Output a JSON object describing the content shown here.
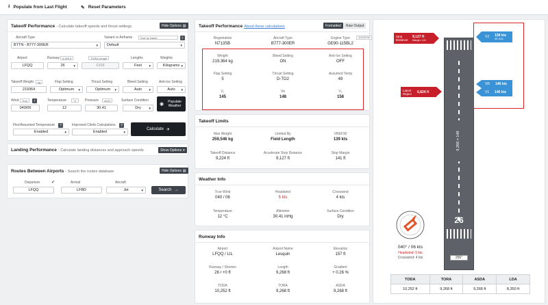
{
  "toolbar": {
    "populate": "Populate from Last Flight",
    "reset": "Reset Parameters"
  },
  "takeoff": {
    "title": "Takeoff Performance",
    "subtitle": "- Calculate takeoff speeds and thrust settings",
    "hide": "Hide Options",
    "aircraft_type_label": "Aircraft Type",
    "aircraft_type": "BTTN - B777-300ER",
    "variant_label": "Variant or Airframe",
    "sort": "Sort by Name",
    "variant": "Default",
    "airport_label": "Airport",
    "airport": "LFQQ",
    "runway_label": "Runway",
    "runway_tag": "5,269 ft",
    "runway": "26",
    "length_tag": "TORA Length",
    "length": "5268",
    "lengths_label": "Lengths",
    "lengths": "Feet",
    "weights_label": "Weights",
    "weights": "Kilograms",
    "tow_label": "Takeoff Weight",
    "tow_tag": "kg",
    "tow": "219364",
    "flap_label": "Flap Setting",
    "flap": "Optimum",
    "thrust_label": "Thrust Setting",
    "thrust": "Optimum",
    "bleed_label": "Bleed Setting",
    "bleed": "Auto",
    "antiice_label": "Anti-Ice Setting",
    "antiice": "Auto",
    "wind_label": "Wind",
    "wind_tag": "True",
    "wind": "040/06",
    "temp_label": "Temperature",
    "temp_tag": "°C",
    "temp": "12",
    "press_label": "Pressure",
    "press_tag": "inHG",
    "press": "30.41",
    "surface_label": "Surface Condition",
    "surface": "Dry",
    "populate_weather": "Populate Weather",
    "flex_label": "Flex/Assumed Temperature",
    "flex": "Enabled",
    "climb_label": "Improved Climb Calculations",
    "climb": "Enabled",
    "calculate": "Calculate"
  },
  "landing": {
    "title": "Landing Performance",
    "subtitle": "- Calculate landing distances and approach speeds",
    "show": "Show Options"
  },
  "routes": {
    "title": "Routes Between Airports",
    "subtitle": "- Search the routes database",
    "hide": "Hide Options",
    "dep_label": "Departure",
    "dep": "LFQQ",
    "arr_label": "Arrival",
    "arr": "LFBD",
    "ac_label": "Aircraft",
    "ac": "Jet",
    "search": "Search"
  },
  "result": {
    "title": "Takeoff Performance",
    "link": "About these calculations",
    "fmt": "Formatted",
    "raw": "Raw Output",
    "rows": [
      [
        {
          "k": "Registration",
          "v": "N713SB"
        },
        {
          "k": "Aircraft Type",
          "v": "B777-300ER"
        },
        {
          "k": "Engine Type",
          "v": "GE90-115BL2",
          "tag": "116,000 lbf"
        }
      ],
      [
        {
          "k": "Weight",
          "v": "219,364 kg"
        },
        {
          "k": "Bleed Setting",
          "v": "ON"
        },
        {
          "k": "Anti-Ice Setting",
          "v": "OFF"
        }
      ],
      [
        {
          "k": "Flap Setting",
          "v": "5"
        },
        {
          "k": "Thrust Setting",
          "v": "D-TO2"
        },
        {
          "k": "Assumed Temp",
          "v": "49"
        }
      ],
      [
        {
          "k": "V₁",
          "v": "145"
        },
        {
          "k": "Vʀ",
          "v": "148"
        },
        {
          "k": "V₂",
          "v": "158"
        }
      ]
    ]
  },
  "limits": {
    "title": "Takeoff Limits",
    "rows": [
      [
        {
          "k": "Max Weight",
          "v": "259,546 kg"
        },
        {
          "k": "Limited By",
          "v": "Field Length"
        },
        {
          "k": "VREF30",
          "v": "139 kts"
        }
      ],
      [
        {
          "k": "Takeoff Distance",
          "v": "9,224 ft"
        },
        {
          "k": "Accelerate Stop Distance",
          "v": "9,127 ft"
        },
        {
          "k": "Stop Margin",
          "v": "141 ft"
        }
      ]
    ]
  },
  "weather": {
    "title": "Weather Info",
    "rows": [
      [
        {
          "k": "True Wind",
          "v": "040 / 06"
        },
        {
          "k": "Headwind",
          "v": "5 kts"
        },
        {
          "k": "Crosswind",
          "v": "4 kts"
        }
      ],
      [
        {
          "k": "Temperature",
          "v": "12 °C"
        },
        {
          "k": "Altimeter",
          "v": "30.41 inHg"
        },
        {
          "k": "Surface Condition",
          "v": "Dry"
        }
      ]
    ]
  },
  "runway": {
    "title": "Runway Info",
    "rows": [
      [
        {
          "k": "Airport",
          "v": "LFQQ / LIL"
        },
        {
          "k": "Airport Name",
          "v": "Lesquin"
        },
        {
          "k": "Elevation",
          "v": "157 ft"
        }
      ],
      [
        {
          "k": "Runway / Shorten",
          "v": "26 / +0 ft"
        },
        {
          "k": "Length",
          "v": "9,268 ft"
        },
        {
          "k": "Gradient",
          "v": "+ 0.26 %"
        }
      ],
      [
        {
          "k": "TODA",
          "v": "10,252 ft"
        },
        {
          "k": "TORA",
          "v": "9,268 ft"
        },
        {
          "k": "ASDA",
          "v": "9,268 ft"
        }
      ]
    ]
  },
  "diagram": {
    "stop_label": "Stop Distance",
    "stop_value": "9,127 ft",
    "stop_margin": "Margin: 141",
    "reject_label": "Latest Reject",
    "reject_value": "6,824 ft",
    "v2_label": "V2",
    "v2_value": "158 kts",
    "v2_sub": "35' AGL",
    "vr_label": "VR",
    "vr_value": "148 kts",
    "v1_label": "V1",
    "v1_value": "145 kts",
    "runway_len": "9,268 × 148",
    "runway_num": "26",
    "heading": "256°",
    "wind_text": "040° / 06 kts",
    "headwind": "Headwind: 5 kts",
    "crosswind": "Crosswind: 4 kts",
    "dist_headers": [
      "TODA",
      "TORA",
      "ASDA",
      "LDA"
    ],
    "dist_values": [
      "10,252 ft",
      "9,268 ft",
      "9,268 ft",
      "8,350 ft"
    ]
  }
}
